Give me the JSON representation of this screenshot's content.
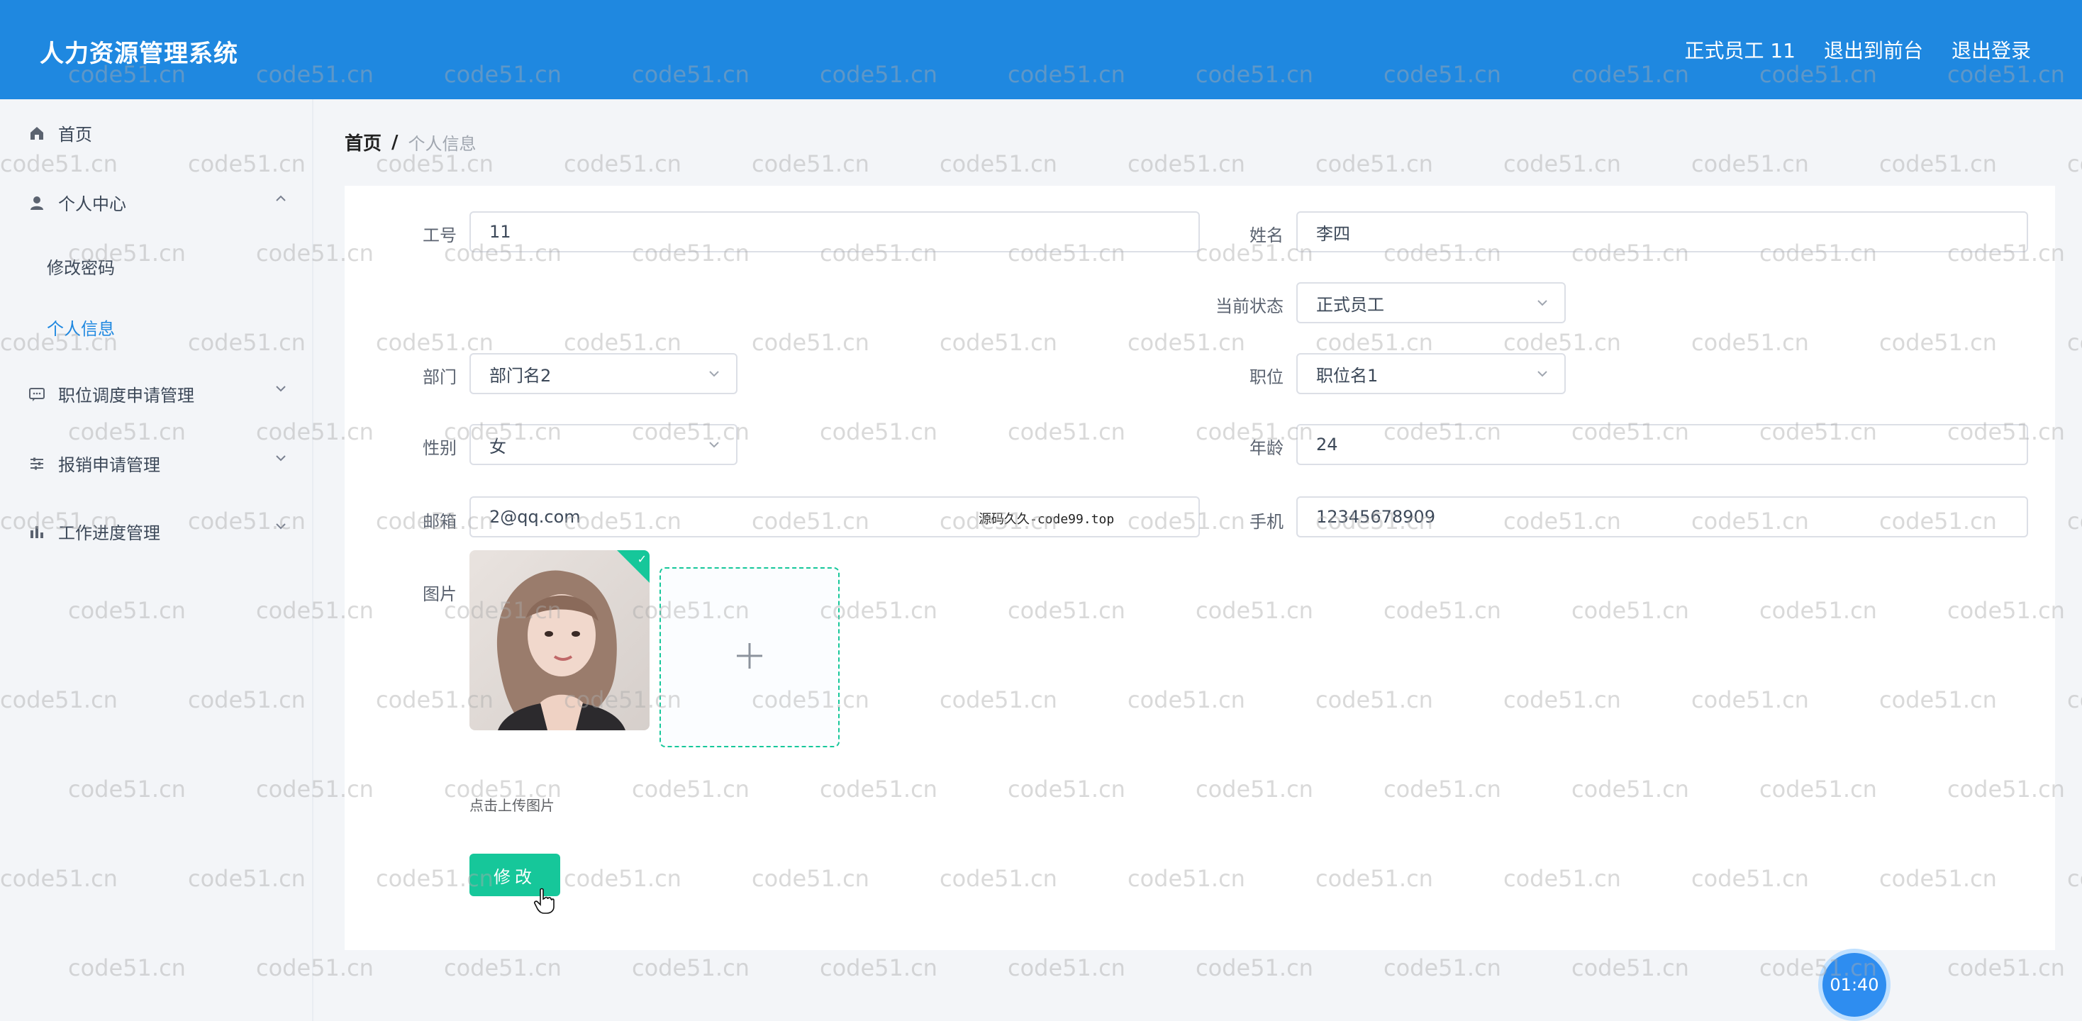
{
  "header": {
    "app_title": "人力资源管理系统",
    "user_label": "正式员工 11",
    "exit_front_label": "退出到前台",
    "logout_label": "退出登录",
    "bg_color": "#1f88e0"
  },
  "sidebar": {
    "home": {
      "label": "首页",
      "icon": "home-icon"
    },
    "personal_center": {
      "label": "个人中心",
      "icon": "user-icon",
      "expanded": true,
      "children": [
        {
          "label": "修改密码",
          "active": false
        },
        {
          "label": "个人信息",
          "active": true
        }
      ]
    },
    "transfer": {
      "label": "职位调度申请管理",
      "icon": "chat-icon"
    },
    "reimburse": {
      "label": "报销申请管理",
      "icon": "sliders-icon"
    },
    "progress": {
      "label": "工作进度管理",
      "icon": "bar-chart-icon"
    }
  },
  "breadcrumb": {
    "home": "首页",
    "separator": "/",
    "current": "个人信息"
  },
  "form": {
    "employee_id": {
      "label": "工号",
      "value": "11"
    },
    "name": {
      "label": "姓名",
      "value": "李四"
    },
    "status": {
      "label": "当前状态",
      "value": "正式员工"
    },
    "department": {
      "label": "部门",
      "value": "部门名2"
    },
    "position": {
      "label": "职位",
      "value": "职位名1"
    },
    "gender": {
      "label": "性别",
      "value": "女"
    },
    "age": {
      "label": "年龄",
      "value": "24"
    },
    "email": {
      "label": "邮箱",
      "value": "2@qq.com"
    },
    "phone": {
      "label": "手机",
      "value": "12345678909"
    },
    "photo": {
      "label": "图片",
      "upload_hint": "点击上传图片"
    },
    "submit_label": "修改"
  },
  "overlay": {
    "source_note": "源码久久-code99.top",
    "watermark_text": "code51.cn",
    "timer": "01:40"
  },
  "colors": {
    "accent": "#1f88e0",
    "success": "#16c79a",
    "active_link": "#1f88e0"
  }
}
